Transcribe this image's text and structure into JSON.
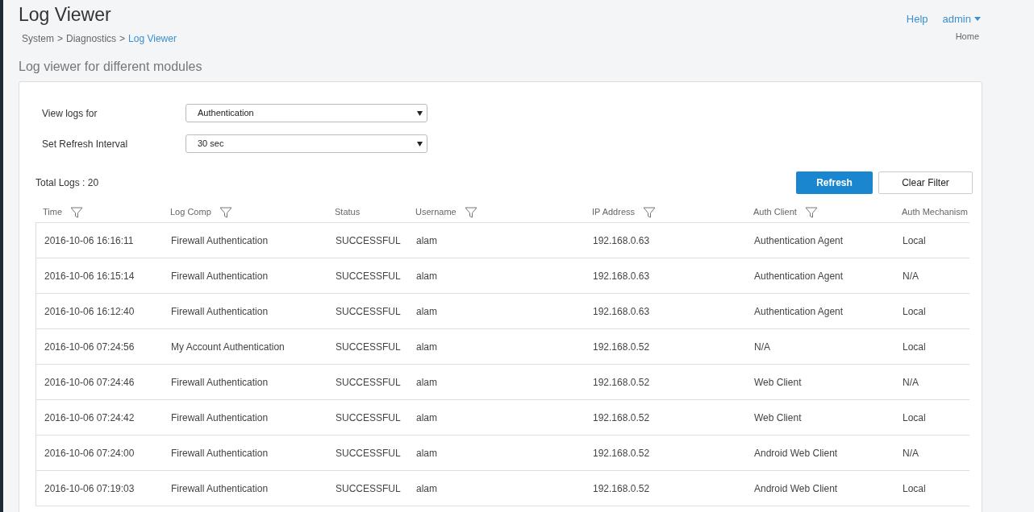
{
  "page": {
    "title": "Log Viewer",
    "breadcrumb_separator": ">",
    "breadcrumb": [
      {
        "label": "System",
        "current": false
      },
      {
        "label": "Diagnostics",
        "current": false
      },
      {
        "label": "Log Viewer",
        "current": true
      }
    ]
  },
  "header_links": {
    "help": "Help",
    "user": "admin",
    "home": "Home"
  },
  "section_title": "Log viewer for different modules",
  "form": [
    {
      "label": "View logs for",
      "value": "Authentication"
    },
    {
      "label": "Set Refresh Interval",
      "value": "30 sec"
    }
  ],
  "total_logs": "Total Logs : 20",
  "buttons": [
    {
      "label": "Refresh",
      "kind": "primary"
    },
    {
      "label": "Clear Filter",
      "kind": "default"
    }
  ],
  "table": {
    "columns": [
      {
        "label": "Time",
        "filter": true
      },
      {
        "label": "Log Comp",
        "filter": true
      },
      {
        "label": "Status",
        "filter": false
      },
      {
        "label": "Username",
        "filter": true
      },
      {
        "label": "IP Address",
        "filter": true
      },
      {
        "label": "Auth Client",
        "filter": true
      },
      {
        "label": "Auth Mechanism",
        "filter": false
      }
    ],
    "rows": [
      [
        "2016-10-06 16:16:11",
        "Firewall Authentication",
        "SUCCESSFUL",
        "alam",
        "192.168.0.63",
        "Authentication Agent",
        "Local"
      ],
      [
        "2016-10-06 16:15:14",
        "Firewall Authentication",
        "SUCCESSFUL",
        "alam",
        "192.168.0.63",
        "Authentication Agent",
        "N/A"
      ],
      [
        "2016-10-06 16:12:40",
        "Firewall Authentication",
        "SUCCESSFUL",
        "alam",
        "192.168.0.63",
        "Authentication Agent",
        "Local"
      ],
      [
        "2016-10-06 07:24:56",
        "My Account Authentication",
        "SUCCESSFUL",
        "alam",
        "192.168.0.52",
        "N/A",
        "Local"
      ],
      [
        "2016-10-06 07:24:46",
        "Firewall Authentication",
        "SUCCESSFUL",
        "alam",
        "192.168.0.52",
        "Web Client",
        "N/A"
      ],
      [
        "2016-10-06 07:24:42",
        "Firewall Authentication",
        "SUCCESSFUL",
        "alam",
        "192.168.0.52",
        "Web Client",
        "Local"
      ],
      [
        "2016-10-06 07:24:00",
        "Firewall Authentication",
        "SUCCESSFUL",
        "alam",
        "192.168.0.52",
        "Android Web Client",
        "N/A"
      ],
      [
        "2016-10-06 07:19:03",
        "Firewall Authentication",
        "SUCCESSFUL",
        "alam",
        "192.168.0.52",
        "Android Web Client",
        "Local"
      ]
    ]
  }
}
